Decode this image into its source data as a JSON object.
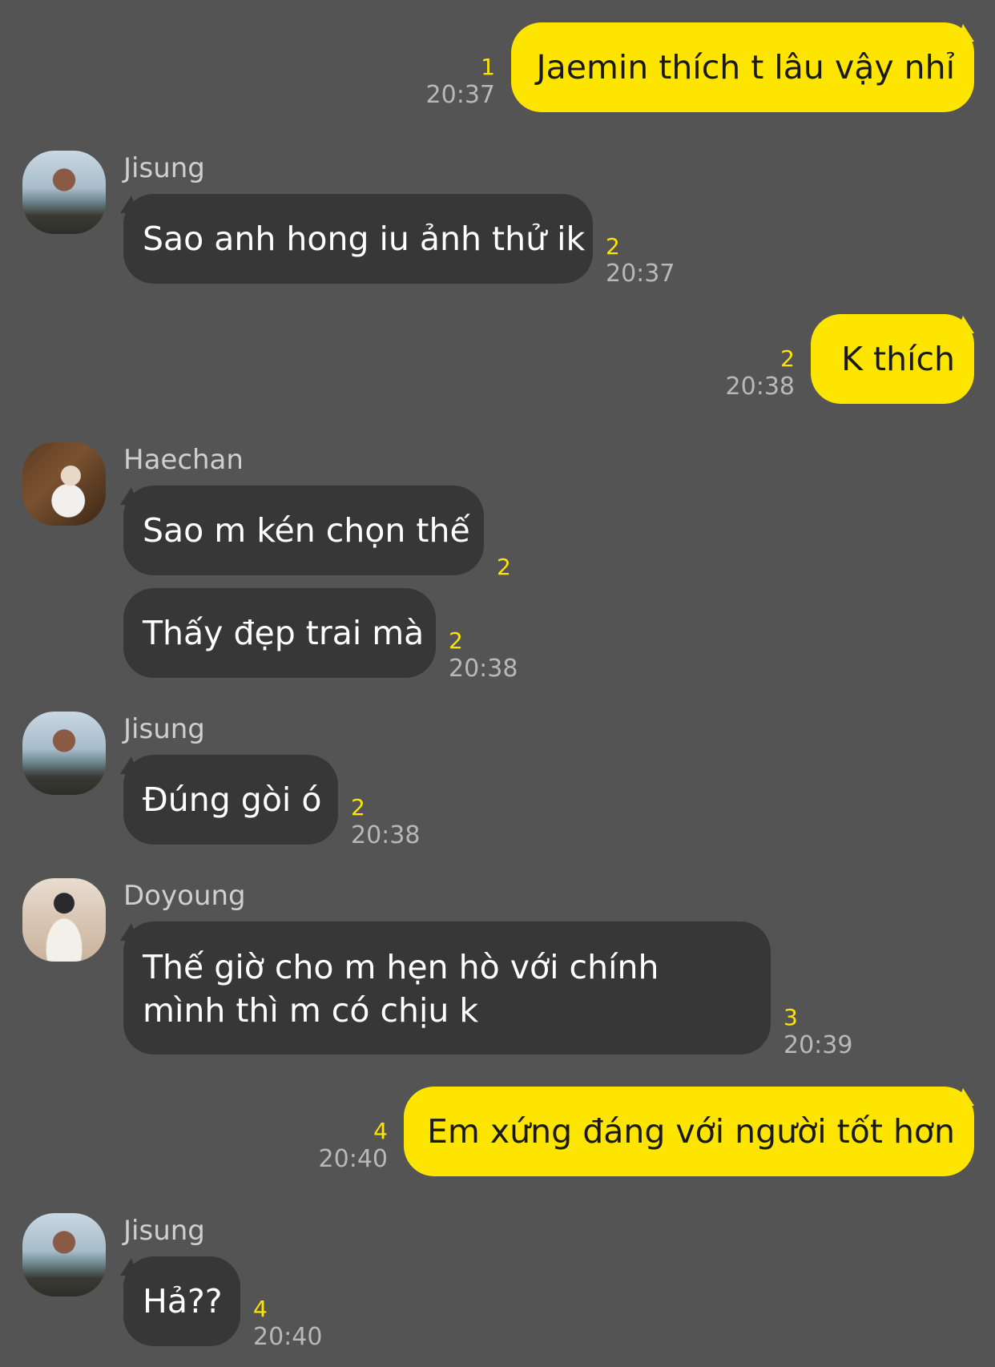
{
  "theme": {
    "background": "#545454",
    "outgoing_bubble": "#fee500",
    "incoming_bubble": "#373737",
    "read_count_color": "#fee500"
  },
  "messages": [
    {
      "direction": "out",
      "text": "Jaemin thích t lâu vậy nhỉ",
      "count": "1",
      "time": "20:37"
    },
    {
      "direction": "in",
      "sender": "Jisung",
      "avatar": "jisung-avatar",
      "text": "Sao anh hong iu ảnh thử ik",
      "count": "2",
      "time": "20:37"
    },
    {
      "direction": "out",
      "text": "K thích",
      "count": "2",
      "time": "20:38"
    },
    {
      "direction": "in",
      "sender": "Haechan",
      "avatar": "haechan-avatar",
      "text": "Sao m kén chọn thế",
      "count": "2"
    },
    {
      "direction": "in",
      "text": "Thấy đẹp trai mà",
      "count": "2",
      "time": "20:38"
    },
    {
      "direction": "in",
      "sender": "Jisung",
      "avatar": "jisung-avatar",
      "text": "Đúng gòi ó",
      "count": "2",
      "time": "20:38"
    },
    {
      "direction": "in",
      "sender": "Doyoung",
      "avatar": "doyoung-avatar",
      "text": "Thế giờ cho m hẹn hò với chính mình thì m có chịu k",
      "count": "3",
      "time": "20:39"
    },
    {
      "direction": "out",
      "text": "Em xứng đáng với người tốt hơn",
      "count": "4",
      "time": "20:40"
    },
    {
      "direction": "in",
      "sender": "Jisung",
      "avatar": "jisung-avatar",
      "text": "Hả??",
      "count": "4",
      "time": "20:40"
    }
  ]
}
